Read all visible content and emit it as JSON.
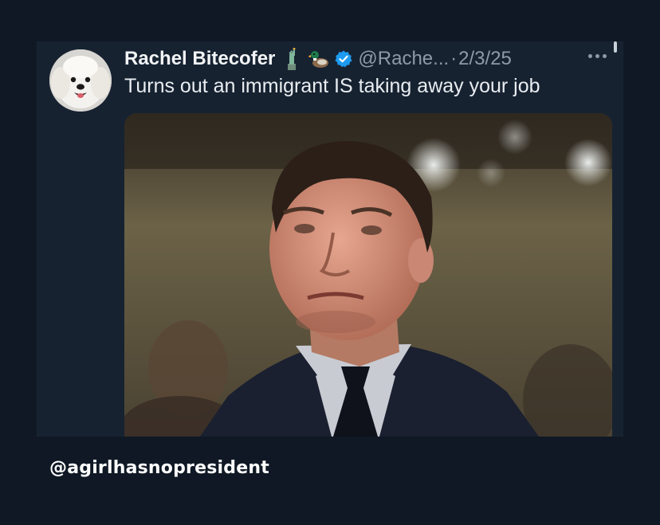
{
  "post": {
    "author_name": "Rachel Bitecofer",
    "author_emojis": [
      "statue-of-liberty",
      "duck"
    ],
    "verified": true,
    "handle": "@Rache...",
    "separator": "·",
    "date": "2/3/25",
    "text": "Turns out an immigrant IS taking away your job",
    "media_description_icon": "photo"
  },
  "overlay": {
    "watermark": "@agirlhasnopresident"
  },
  "colors": {
    "page_background": "#0f1824",
    "card_background": "#172231",
    "verified_blue": "#1d9bf0",
    "muted_text": "#8d9aa8"
  }
}
